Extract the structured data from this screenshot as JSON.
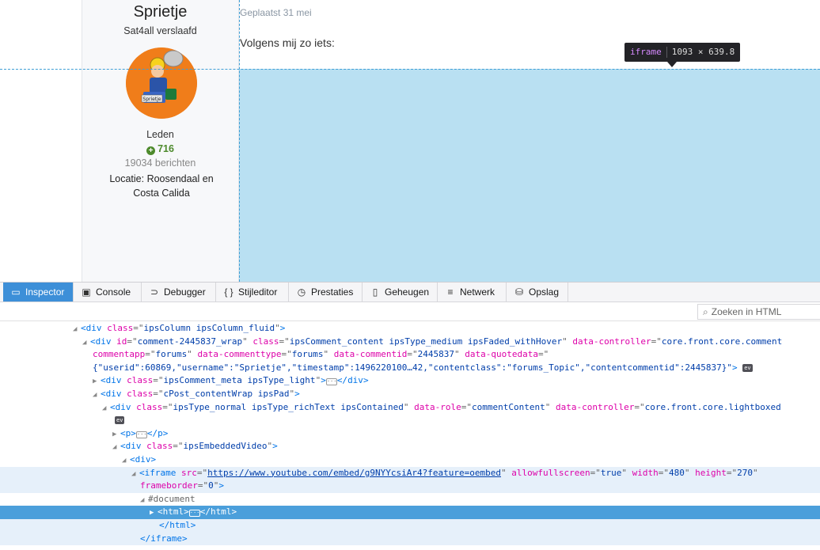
{
  "author": {
    "name": "Sprietje",
    "title": "Sat4all verslaafd",
    "avatar_label": "Sprietje",
    "group": "Leden",
    "reputation": "716",
    "posts": "19034 berichten",
    "location": "Locatie: Roosendaal en Costa Calida"
  },
  "post": {
    "date": "Geplaatst 31 mei",
    "text": "Volgens mij zo iets:"
  },
  "tooltip": {
    "tag": "iframe",
    "size": "1093 × 639.8"
  },
  "devtools": {
    "tabs": [
      {
        "label": "Inspector",
        "icon": "inspector-icon"
      },
      {
        "label": "Console",
        "icon": "console-icon"
      },
      {
        "label": "Debugger",
        "icon": "debugger-icon"
      },
      {
        "label": "Stijleditor",
        "icon": "style-editor-icon"
      },
      {
        "label": "Prestaties",
        "icon": "performance-icon"
      },
      {
        "label": "Geheugen",
        "icon": "memory-icon"
      },
      {
        "label": "Netwerk",
        "icon": "network-icon"
      },
      {
        "label": "Opslag",
        "icon": "storage-icon"
      }
    ],
    "search_placeholder": "Zoeken in HTML",
    "tree": {
      "l1": {
        "tag": "div",
        "class": "ipsColumn ipsColumn_fluid"
      },
      "l2": {
        "tag": "div",
        "id": "comment-2445837_wrap",
        "class": "ipsComment_content ipsType_medium ipsFaded_withHover",
        "controller": "core.front.core.comment"
      },
      "l3": {
        "commentapp": "forums",
        "commenttype": "forums",
        "commentid": "2445837",
        "quotedata_open": "\""
      },
      "l4": {
        "quotedata": "{\"userid\":60869,\"username\":\"Sprietje\",\"timestamp\":1496220100…42,\"contentclass\":\"forums_Topic\",\"contentcommentid\":2445837}\""
      },
      "l5": {
        "tag": "div",
        "class": "ipsComment_meta ipsType_light"
      },
      "l6": {
        "tag": "div",
        "class": "cPost_contentWrap ipsPad"
      },
      "l7": {
        "tag": "div",
        "class": "ipsType_normal ipsType_richText ipsContained",
        "role": "commentContent",
        "controller": "core.front.core.lightboxed"
      },
      "l9": {
        "tag": "p"
      },
      "l10": {
        "tag": "div",
        "class": "ipsEmbeddedVideo"
      },
      "l11": {
        "tag": "div"
      },
      "l12": {
        "tag": "iframe",
        "src": "https://www.youtube.com/embed/g9NYYcsiAr4?feature=oembed",
        "allowfullscreen": "true",
        "width": "480",
        "height": "270"
      },
      "l13": {
        "frameborder": "0"
      },
      "l14": {
        "text": "#document"
      },
      "l15": {
        "tag": "html"
      },
      "l16": {
        "tag": "html"
      },
      "l17": {
        "tag": "iframe"
      },
      "ev": "ev"
    }
  }
}
